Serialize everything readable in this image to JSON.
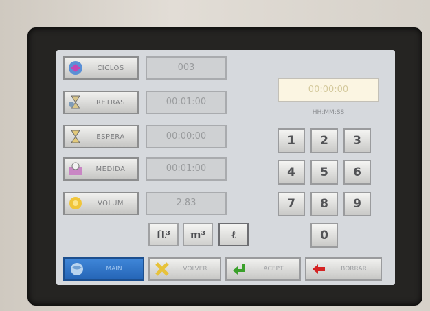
{
  "side": [
    {
      "label": "CICLOS",
      "value": "003"
    },
    {
      "label": "RETRAS",
      "value": "00:01:00"
    },
    {
      "label": "ESPERA",
      "value": "00:00:00"
    },
    {
      "label": "MEDIDA",
      "value": "00:01:00"
    },
    {
      "label": "VOLUM",
      "value": "2.83"
    }
  ],
  "display": {
    "value": "00:00:00",
    "format": "HH:MM:SS"
  },
  "keypad": [
    "1",
    "2",
    "3",
    "4",
    "5",
    "6",
    "7",
    "8",
    "9",
    "0"
  ],
  "units": [
    "ft³",
    "m³",
    "ℓ"
  ],
  "bottom": {
    "main": "MAIN",
    "volver": "VOLVER",
    "acept": "ACEPT",
    "borrar": "BORRAR"
  },
  "colors": {
    "main_button": "#2f74c8",
    "display_bg": "#fbf5e2",
    "accept_arrow": "#3aa02a",
    "delete_arrow": "#d42323"
  }
}
